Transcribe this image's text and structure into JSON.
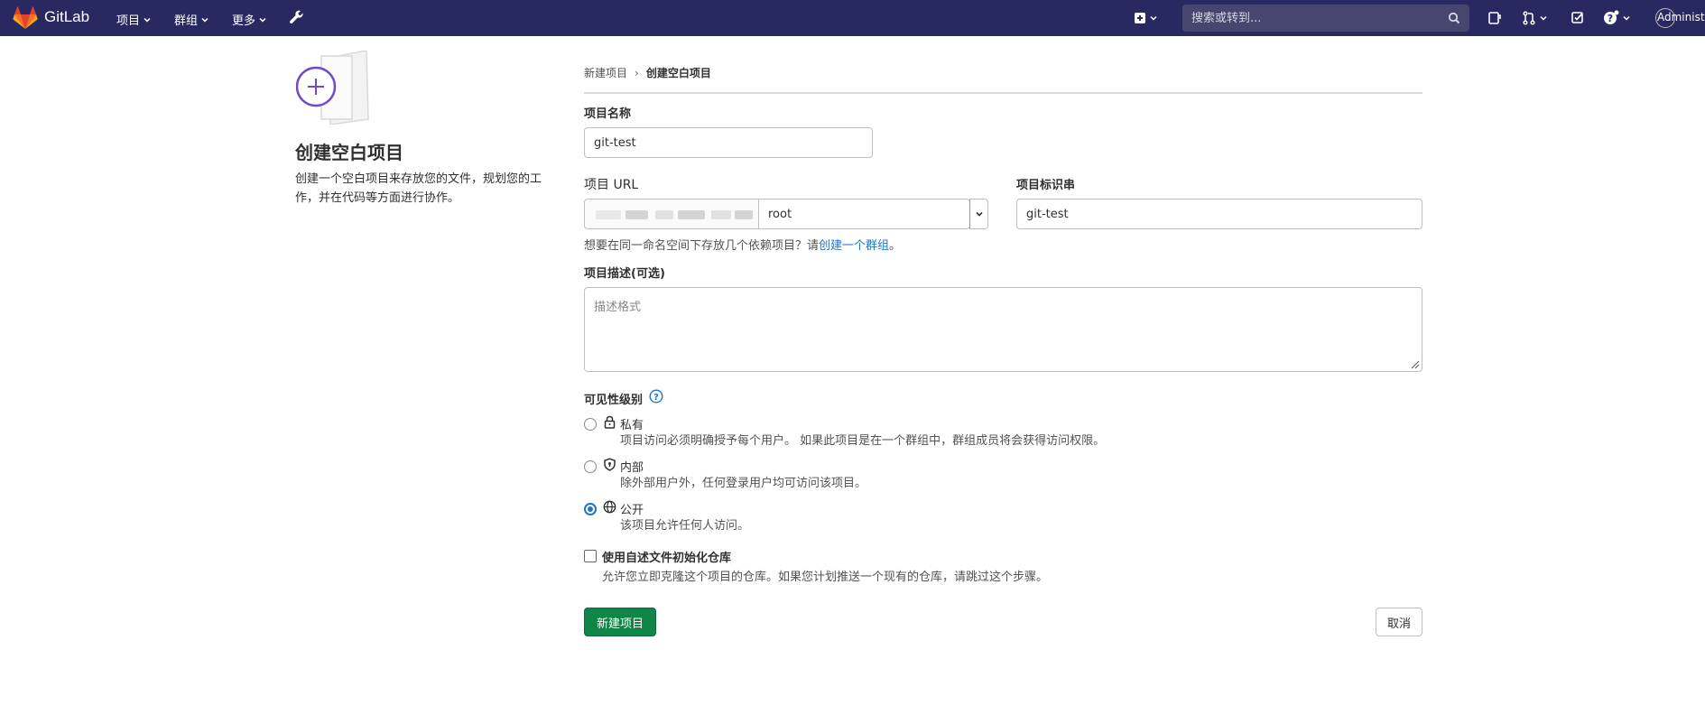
{
  "navbar": {
    "brand": "GitLab",
    "menus": [
      {
        "label": "项目"
      },
      {
        "label": "群组"
      },
      {
        "label": "更多"
      }
    ],
    "search_placeholder": "搜索或转到...",
    "user_label": "Administrator",
    "bg_color": "#292961"
  },
  "left": {
    "title": "创建空白项目",
    "description": "创建一个空白项目来存放您的文件，规划您的工作，并在代码等方面进行协作。"
  },
  "breadcrumb": {
    "parent": "新建项目",
    "separator": "›",
    "current": "创建空白项目"
  },
  "form": {
    "project_name_label": "项目名称",
    "project_name_value": "git-test",
    "project_url_label": "项目 URL",
    "namespace_value": "root",
    "project_slug_label": "项目标识串",
    "project_slug_value": "git-test",
    "help_text": "想要在同一命名空间下存放几个依赖项目？请",
    "help_link": "创建一个群组",
    "help_suffix": "。",
    "description_label": "项目描述(可选)",
    "description_placeholder": "描述格式",
    "visibility_label": "可见性级别",
    "visibility_options": [
      {
        "title": "私有",
        "description": "项目访问必须明确授予每个用户。 如果此项目是在一个群组中，群组成员将会获得访问权限。",
        "icon": "lock-icon",
        "checked": false
      },
      {
        "title": "内部",
        "description": "除外部用户外，任何登录用户均可访问该项目。",
        "icon": "shield-icon",
        "checked": false
      },
      {
        "title": "公开",
        "description": "该项目允许任何人访问。",
        "icon": "globe-icon",
        "checked": true
      }
    ],
    "init_readme_label": "使用自述文件初始化仓库",
    "init_readme_desc": "允许您立即克隆这个项目的仓库。如果您计划推送一个现有的仓库，请跳过这个步骤。",
    "init_readme_checked": false,
    "create_button": "新建项目",
    "cancel_button": "取消"
  },
  "colors": {
    "primary_green": "#108548",
    "link_blue": "#1f75cb",
    "accent_purple": "#6e49cb"
  }
}
